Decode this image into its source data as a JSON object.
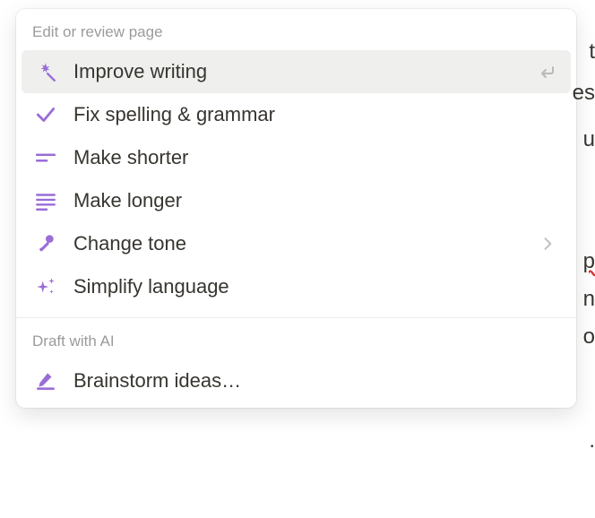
{
  "accent": "#9a6dd7",
  "sections": {
    "edit_review": {
      "header": "Edit or review page",
      "items": {
        "improve_writing": {
          "label": "Improve writing"
        },
        "fix_spelling": {
          "label": "Fix spelling & grammar"
        },
        "make_shorter": {
          "label": "Make shorter"
        },
        "make_longer": {
          "label": "Make longer"
        },
        "change_tone": {
          "label": "Change tone"
        },
        "simplify": {
          "label": "Simplify language"
        }
      }
    },
    "draft_ai": {
      "header": "Draft with AI",
      "items": {
        "brainstorm": {
          "label": "Brainstorm ideas…"
        }
      }
    }
  },
  "background_fragments": {
    "a": "t",
    "b": "es",
    "c": "u",
    "d": "p",
    "e": "n",
    "f": "o",
    "g": "."
  }
}
